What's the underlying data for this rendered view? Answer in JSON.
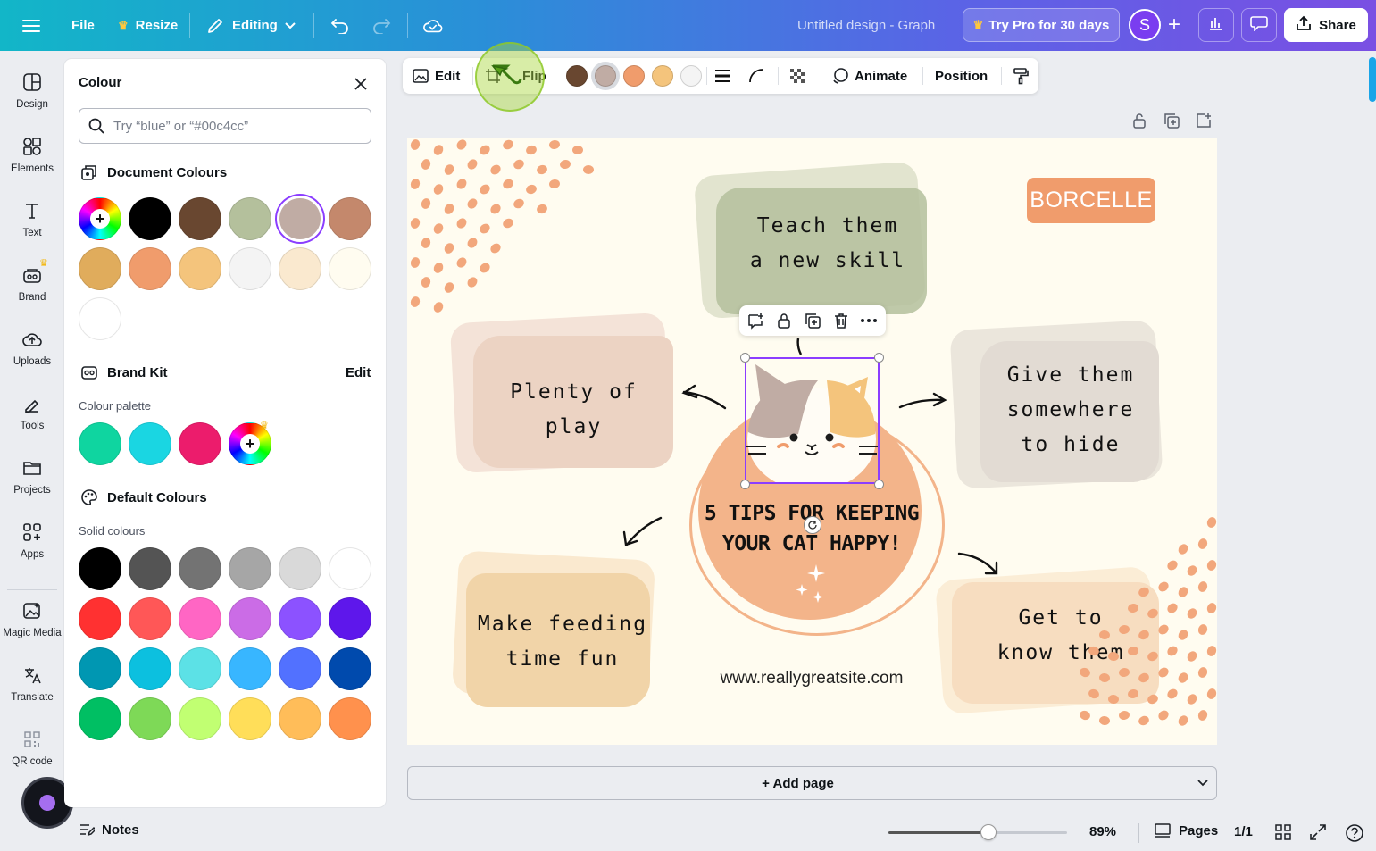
{
  "topbar": {
    "file": "File",
    "resize": "Resize",
    "editing": "Editing",
    "design_title": "Untitled design - Graph",
    "try_pro": "Try Pro for 30 days",
    "avatar_initial": "S",
    "share": "Share"
  },
  "rail": {
    "items": [
      "Design",
      "Elements",
      "Text",
      "Brand",
      "Uploads",
      "Tools",
      "Projects",
      "Apps",
      "Magic Media",
      "Translate",
      "QR code"
    ]
  },
  "panel": {
    "title": "Colour",
    "search_placeholder": "Try “blue” or “#00c4cc”",
    "document_colours_title": "Document Colours",
    "document_colours": [
      "#000000",
      "#694730",
      "#b4c09c",
      "#c0aca4",
      "#c4886c",
      "#e0ac5c",
      "#f09c6c",
      "#f4c47c",
      "#f4f4f4",
      "#fae9cf",
      "#fffcf0",
      "#ffffff"
    ],
    "brand_kit_title": "Brand Kit",
    "brand_kit_edit": "Edit",
    "colour_palette_label": "Colour palette",
    "brand_colours": [
      "#0fd5a0",
      "#1ad6e2",
      "#ec1c6c"
    ],
    "default_colours_title": "Default Colours",
    "solid_colours_label": "Solid colours",
    "solid_colours": [
      "#000000",
      "#545454",
      "#737373",
      "#a6a6a6",
      "#d9d9d9",
      "#ffffff",
      "#ff3131",
      "#ff5757",
      "#ff66c4",
      "#cb6ce6",
      "#8c52ff",
      "#5e17eb",
      "#0097b2",
      "#0cc0df",
      "#5ce1e6",
      "#38b6ff",
      "#5271ff",
      "#004aad",
      "#00bf63",
      "#7ed957",
      "#c1ff72",
      "#ffde59",
      "#ffbd59",
      "#ff914d"
    ]
  },
  "context_bar": {
    "edit": "Edit",
    "flip": "Flip",
    "colours": [
      "#694730",
      "#c0aca4",
      "#f09c6c",
      "#f4c47c",
      "#f4f4f4"
    ],
    "animate": "Animate",
    "position": "Position"
  },
  "design": {
    "brand": "BORCELLE",
    "tip1": [
      "Teach them",
      "a new skill"
    ],
    "tip2": [
      "Plenty of play"
    ],
    "tip3": [
      "Give them",
      "somewhere",
      "to hide"
    ],
    "tip4": [
      "Make feeding",
      "time fun"
    ],
    "tip5": [
      "Get to",
      "know them"
    ],
    "center_title": [
      "5 TIPS FOR KEEPING",
      "YOUR CAT HAPPY!"
    ],
    "website": "www.reallygreatsite.com"
  },
  "add_page": "+ Add page",
  "bottom": {
    "notes": "Notes",
    "zoom": "89%",
    "zoom_fraction": 0.56,
    "pages": "Pages",
    "page_count": "1/1"
  }
}
